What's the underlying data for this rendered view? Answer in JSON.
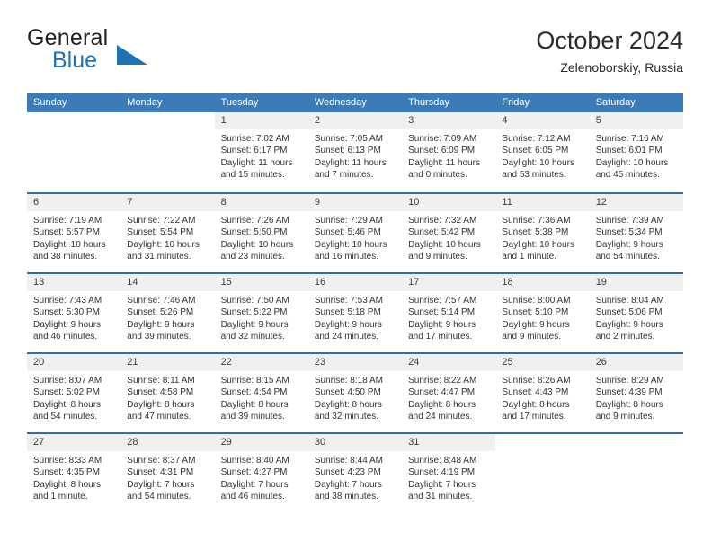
{
  "brand": {
    "word1": "General",
    "word2": "Blue",
    "accent_color": "#1e72b8",
    "triangle_icon": "brand-triangle-icon"
  },
  "header": {
    "title": "October 2024",
    "subtitle": "Zelenoborskiy, Russia"
  },
  "theme": {
    "header_blue": "#3b7cb8",
    "rule_blue": "#2e6fab",
    "daynum_band": "#f0f0f0",
    "text": "#333333"
  },
  "weekdays": [
    "Sunday",
    "Monday",
    "Tuesday",
    "Wednesday",
    "Thursday",
    "Friday",
    "Saturday"
  ],
  "weeks": [
    [
      {
        "empty": true
      },
      {
        "empty": true
      },
      {
        "day": "1",
        "sunrise": "Sunrise: 7:02 AM",
        "sunset": "Sunset: 6:17 PM",
        "daylight1": "Daylight: 11 hours",
        "daylight2": "and 15 minutes."
      },
      {
        "day": "2",
        "sunrise": "Sunrise: 7:05 AM",
        "sunset": "Sunset: 6:13 PM",
        "daylight1": "Daylight: 11 hours",
        "daylight2": "and 7 minutes."
      },
      {
        "day": "3",
        "sunrise": "Sunrise: 7:09 AM",
        "sunset": "Sunset: 6:09 PM",
        "daylight1": "Daylight: 11 hours",
        "daylight2": "and 0 minutes."
      },
      {
        "day": "4",
        "sunrise": "Sunrise: 7:12 AM",
        "sunset": "Sunset: 6:05 PM",
        "daylight1": "Daylight: 10 hours",
        "daylight2": "and 53 minutes."
      },
      {
        "day": "5",
        "sunrise": "Sunrise: 7:16 AM",
        "sunset": "Sunset: 6:01 PM",
        "daylight1": "Daylight: 10 hours",
        "daylight2": "and 45 minutes."
      }
    ],
    [
      {
        "day": "6",
        "sunrise": "Sunrise: 7:19 AM",
        "sunset": "Sunset: 5:57 PM",
        "daylight1": "Daylight: 10 hours",
        "daylight2": "and 38 minutes."
      },
      {
        "day": "7",
        "sunrise": "Sunrise: 7:22 AM",
        "sunset": "Sunset: 5:54 PM",
        "daylight1": "Daylight: 10 hours",
        "daylight2": "and 31 minutes."
      },
      {
        "day": "8",
        "sunrise": "Sunrise: 7:26 AM",
        "sunset": "Sunset: 5:50 PM",
        "daylight1": "Daylight: 10 hours",
        "daylight2": "and 23 minutes."
      },
      {
        "day": "9",
        "sunrise": "Sunrise: 7:29 AM",
        "sunset": "Sunset: 5:46 PM",
        "daylight1": "Daylight: 10 hours",
        "daylight2": "and 16 minutes."
      },
      {
        "day": "10",
        "sunrise": "Sunrise: 7:32 AM",
        "sunset": "Sunset: 5:42 PM",
        "daylight1": "Daylight: 10 hours",
        "daylight2": "and 9 minutes."
      },
      {
        "day": "11",
        "sunrise": "Sunrise: 7:36 AM",
        "sunset": "Sunset: 5:38 PM",
        "daylight1": "Daylight: 10 hours",
        "daylight2": "and 1 minute."
      },
      {
        "day": "12",
        "sunrise": "Sunrise: 7:39 AM",
        "sunset": "Sunset: 5:34 PM",
        "daylight1": "Daylight: 9 hours",
        "daylight2": "and 54 minutes."
      }
    ],
    [
      {
        "day": "13",
        "sunrise": "Sunrise: 7:43 AM",
        "sunset": "Sunset: 5:30 PM",
        "daylight1": "Daylight: 9 hours",
        "daylight2": "and 46 minutes."
      },
      {
        "day": "14",
        "sunrise": "Sunrise: 7:46 AM",
        "sunset": "Sunset: 5:26 PM",
        "daylight1": "Daylight: 9 hours",
        "daylight2": "and 39 minutes."
      },
      {
        "day": "15",
        "sunrise": "Sunrise: 7:50 AM",
        "sunset": "Sunset: 5:22 PM",
        "daylight1": "Daylight: 9 hours",
        "daylight2": "and 32 minutes."
      },
      {
        "day": "16",
        "sunrise": "Sunrise: 7:53 AM",
        "sunset": "Sunset: 5:18 PM",
        "daylight1": "Daylight: 9 hours",
        "daylight2": "and 24 minutes."
      },
      {
        "day": "17",
        "sunrise": "Sunrise: 7:57 AM",
        "sunset": "Sunset: 5:14 PM",
        "daylight1": "Daylight: 9 hours",
        "daylight2": "and 17 minutes."
      },
      {
        "day": "18",
        "sunrise": "Sunrise: 8:00 AM",
        "sunset": "Sunset: 5:10 PM",
        "daylight1": "Daylight: 9 hours",
        "daylight2": "and 9 minutes."
      },
      {
        "day": "19",
        "sunrise": "Sunrise: 8:04 AM",
        "sunset": "Sunset: 5:06 PM",
        "daylight1": "Daylight: 9 hours",
        "daylight2": "and 2 minutes."
      }
    ],
    [
      {
        "day": "20",
        "sunrise": "Sunrise: 8:07 AM",
        "sunset": "Sunset: 5:02 PM",
        "daylight1": "Daylight: 8 hours",
        "daylight2": "and 54 minutes."
      },
      {
        "day": "21",
        "sunrise": "Sunrise: 8:11 AM",
        "sunset": "Sunset: 4:58 PM",
        "daylight1": "Daylight: 8 hours",
        "daylight2": "and 47 minutes."
      },
      {
        "day": "22",
        "sunrise": "Sunrise: 8:15 AM",
        "sunset": "Sunset: 4:54 PM",
        "daylight1": "Daylight: 8 hours",
        "daylight2": "and 39 minutes."
      },
      {
        "day": "23",
        "sunrise": "Sunrise: 8:18 AM",
        "sunset": "Sunset: 4:50 PM",
        "daylight1": "Daylight: 8 hours",
        "daylight2": "and 32 minutes."
      },
      {
        "day": "24",
        "sunrise": "Sunrise: 8:22 AM",
        "sunset": "Sunset: 4:47 PM",
        "daylight1": "Daylight: 8 hours",
        "daylight2": "and 24 minutes."
      },
      {
        "day": "25",
        "sunrise": "Sunrise: 8:26 AM",
        "sunset": "Sunset: 4:43 PM",
        "daylight1": "Daylight: 8 hours",
        "daylight2": "and 17 minutes."
      },
      {
        "day": "26",
        "sunrise": "Sunrise: 8:29 AM",
        "sunset": "Sunset: 4:39 PM",
        "daylight1": "Daylight: 8 hours",
        "daylight2": "and 9 minutes."
      }
    ],
    [
      {
        "day": "27",
        "sunrise": "Sunrise: 8:33 AM",
        "sunset": "Sunset: 4:35 PM",
        "daylight1": "Daylight: 8 hours",
        "daylight2": "and 1 minute."
      },
      {
        "day": "28",
        "sunrise": "Sunrise: 8:37 AM",
        "sunset": "Sunset: 4:31 PM",
        "daylight1": "Daylight: 7 hours",
        "daylight2": "and 54 minutes."
      },
      {
        "day": "29",
        "sunrise": "Sunrise: 8:40 AM",
        "sunset": "Sunset: 4:27 PM",
        "daylight1": "Daylight: 7 hours",
        "daylight2": "and 46 minutes."
      },
      {
        "day": "30",
        "sunrise": "Sunrise: 8:44 AM",
        "sunset": "Sunset: 4:23 PM",
        "daylight1": "Daylight: 7 hours",
        "daylight2": "and 38 minutes."
      },
      {
        "day": "31",
        "sunrise": "Sunrise: 8:48 AM",
        "sunset": "Sunset: 4:19 PM",
        "daylight1": "Daylight: 7 hours",
        "daylight2": "and 31 minutes."
      },
      {
        "empty": true
      },
      {
        "empty": true
      }
    ]
  ]
}
